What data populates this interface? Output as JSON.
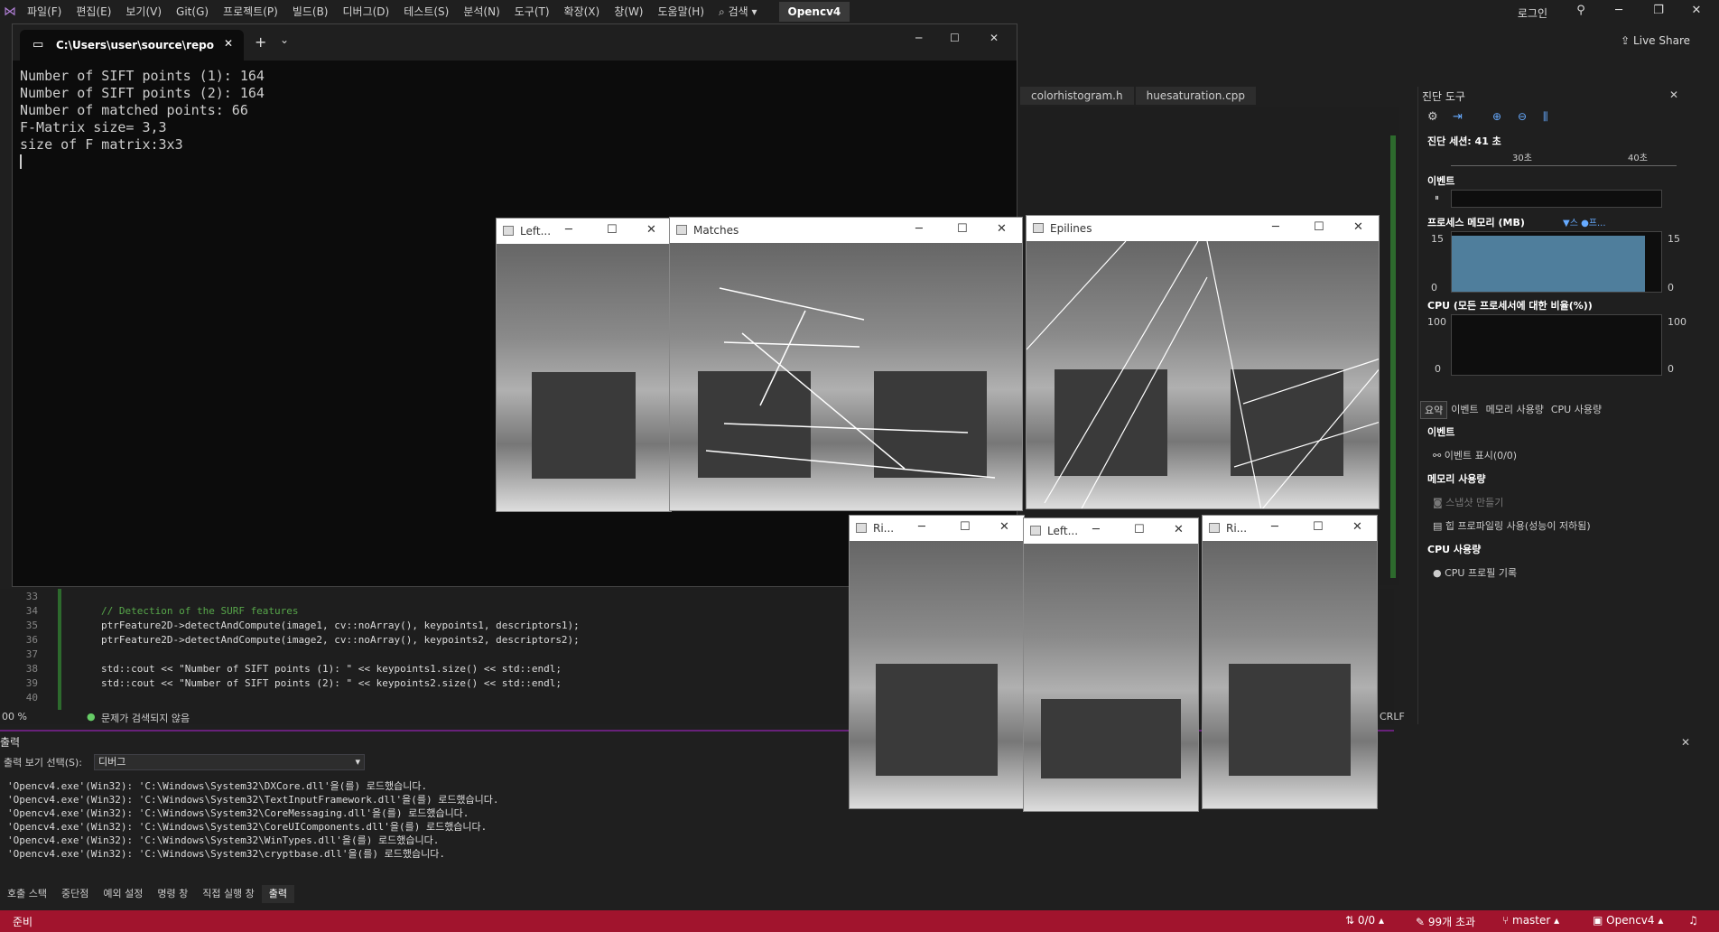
{
  "menu": [
    "파일(F)",
    "편집(E)",
    "보기(V)",
    "Git(G)",
    "프로젝트(P)",
    "빌드(B)",
    "디버그(D)",
    "테스트(S)",
    "분석(N)",
    "도구(T)",
    "확장(X)",
    "창(W)",
    "도움말(H)"
  ],
  "search_label": "검색",
  "project": "Opencv4",
  "login": "로그인",
  "live_share": "Live Share",
  "console": {
    "tab_title": "C:\\Users\\user\\source\\repo",
    "lines": [
      "Number of SIFT points (1): 164",
      "Number of SIFT points (2): 164",
      "Number of matched points: 66",
      "F-Matrix size= 3,3",
      "size of F matrix:3x3"
    ]
  },
  "editor_tabs": [
    "colorhistogram.h",
    "huesaturation.cpp"
  ],
  "code": {
    "numbers": [
      "33",
      "34",
      "35",
      "36",
      "37",
      "38",
      "39",
      "40"
    ],
    "lines": [
      "",
      "// Detection of the SURF features",
      "ptrFeature2D->detectAndCompute(image1, cv::noArray(), keypoints1, descriptors1);",
      "ptrFeature2D->detectAndCompute(image2, cv::noArray(), keypoints2, descriptors2);",
      "",
      "std::cout << \"Number of SIFT points (1): \" << keypoints1.size() << std::endl;",
      "std::cout << \"Number of SIFT points (2): \" << keypoints2.size() << std::endl;",
      ""
    ]
  },
  "editor_status": {
    "zoom": "00 %",
    "issues": "문제가 검색되지 않음",
    "eol": "CRLF"
  },
  "output": {
    "title": "출력",
    "select_label": "출력 보기 선택(S):",
    "select_value": "디버그",
    "lines": [
      "'Opencv4.exe'(Win32): 'C:\\Windows\\System32\\DXCore.dll'을(를) 로드했습니다.",
      "'Opencv4.exe'(Win32): 'C:\\Windows\\System32\\TextInputFramework.dll'을(를) 로드했습니다.",
      "'Opencv4.exe'(Win32): 'C:\\Windows\\System32\\CoreMessaging.dll'을(를) 로드했습니다.",
      "'Opencv4.exe'(Win32): 'C:\\Windows\\System32\\CoreUIComponents.dll'을(를) 로드했습니다.",
      "'Opencv4.exe'(Win32): 'C:\\Windows\\System32\\WinTypes.dll'을(를) 로드했습니다.",
      "'Opencv4.exe'(Win32): 'C:\\Windows\\System32\\cryptbase.dll'을(를) 로드했습니다."
    ]
  },
  "bottom_tabs": [
    "호출 스택",
    "중단점",
    "예외 설정",
    "명령 창",
    "직접 실행 창",
    "출력"
  ],
  "status": {
    "ready": "준비",
    "errors": "0/0",
    "changes": "99개 초과",
    "branch": "master",
    "project": "Opencv4"
  },
  "diag": {
    "title": "진단 도구",
    "session": "진단 세션: 41 초",
    "t30": "30초",
    "t40": "40초",
    "events": "이벤트",
    "mem_title": "프로세스 메모리 (MB)",
    "mem_legend": "▼스 ●프...",
    "mem_max": "15",
    "mem_min": "0",
    "cpu_title": "CPU (모든 프로세서에 대한 비율(%))",
    "cpu_max": "100",
    "cpu_min": "0",
    "tabs": [
      "요약",
      "이벤트",
      "메모리 사용량",
      "CPU 사용량"
    ],
    "sec_events": "이벤트",
    "show_events": "이벤트 표시(0/0)",
    "sec_mem": "메모리 사용량",
    "snapshot": "스냅샷 만들기",
    "heap": "힙 프로파일링 사용(성능이 저하됨)",
    "sec_cpu": "CPU 사용량",
    "cpu_record": "CPU 프로필 기록"
  },
  "windows": [
    "Left...",
    "Matches",
    "Epilines",
    "Ri...",
    "Left...",
    "Ri..."
  ]
}
